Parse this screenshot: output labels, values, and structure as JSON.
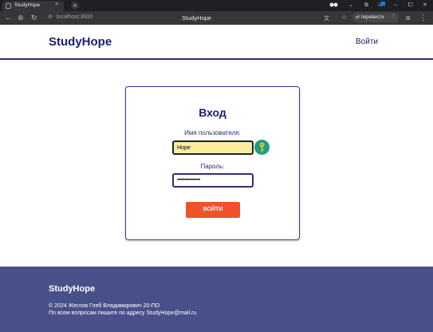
{
  "browser": {
    "tab_title": "StudyHope",
    "tab_close": "×",
    "new_tab": "+",
    "url": "localhost:3000",
    "page_heading": "StudyHope",
    "translate_label": "перевести",
    "icons": [
      "tab-favicon",
      "close-icon",
      "plus-icon",
      "chevron-down-icon",
      "minimize-icon",
      "maximize-icon",
      "close-window-icon",
      "back-icon",
      "forward-icon",
      "reload-icon",
      "site-info-icon",
      "translate-icon",
      "bookmark-star-icon",
      "extensions-icon",
      "profile-icon",
      "menu-icon"
    ]
  },
  "header": {
    "brand": "StudyHope",
    "login_link": "Войти"
  },
  "login_form": {
    "title": "Вход",
    "username_label": "Имя пользователя:",
    "username_value": "Hope",
    "password_label": "Пароль:",
    "password_mask": "••••••••••••••••••",
    "submit_label": "ВОЙТИ"
  },
  "footer": {
    "brand": "StudyHope",
    "copyright": "© 2024 Жеглов Глеб Владимирович 20-ПО",
    "contact": "По всем вопросам пишите по адресу StudyHope@mail.ru"
  },
  "colors": {
    "brand_navy": "#1c1c7a",
    "footer_bg": "#48508a",
    "submit_bg": "#f0522a",
    "autofill_bg": "#fbeca0",
    "password_manager_key": "#1c9e86"
  }
}
